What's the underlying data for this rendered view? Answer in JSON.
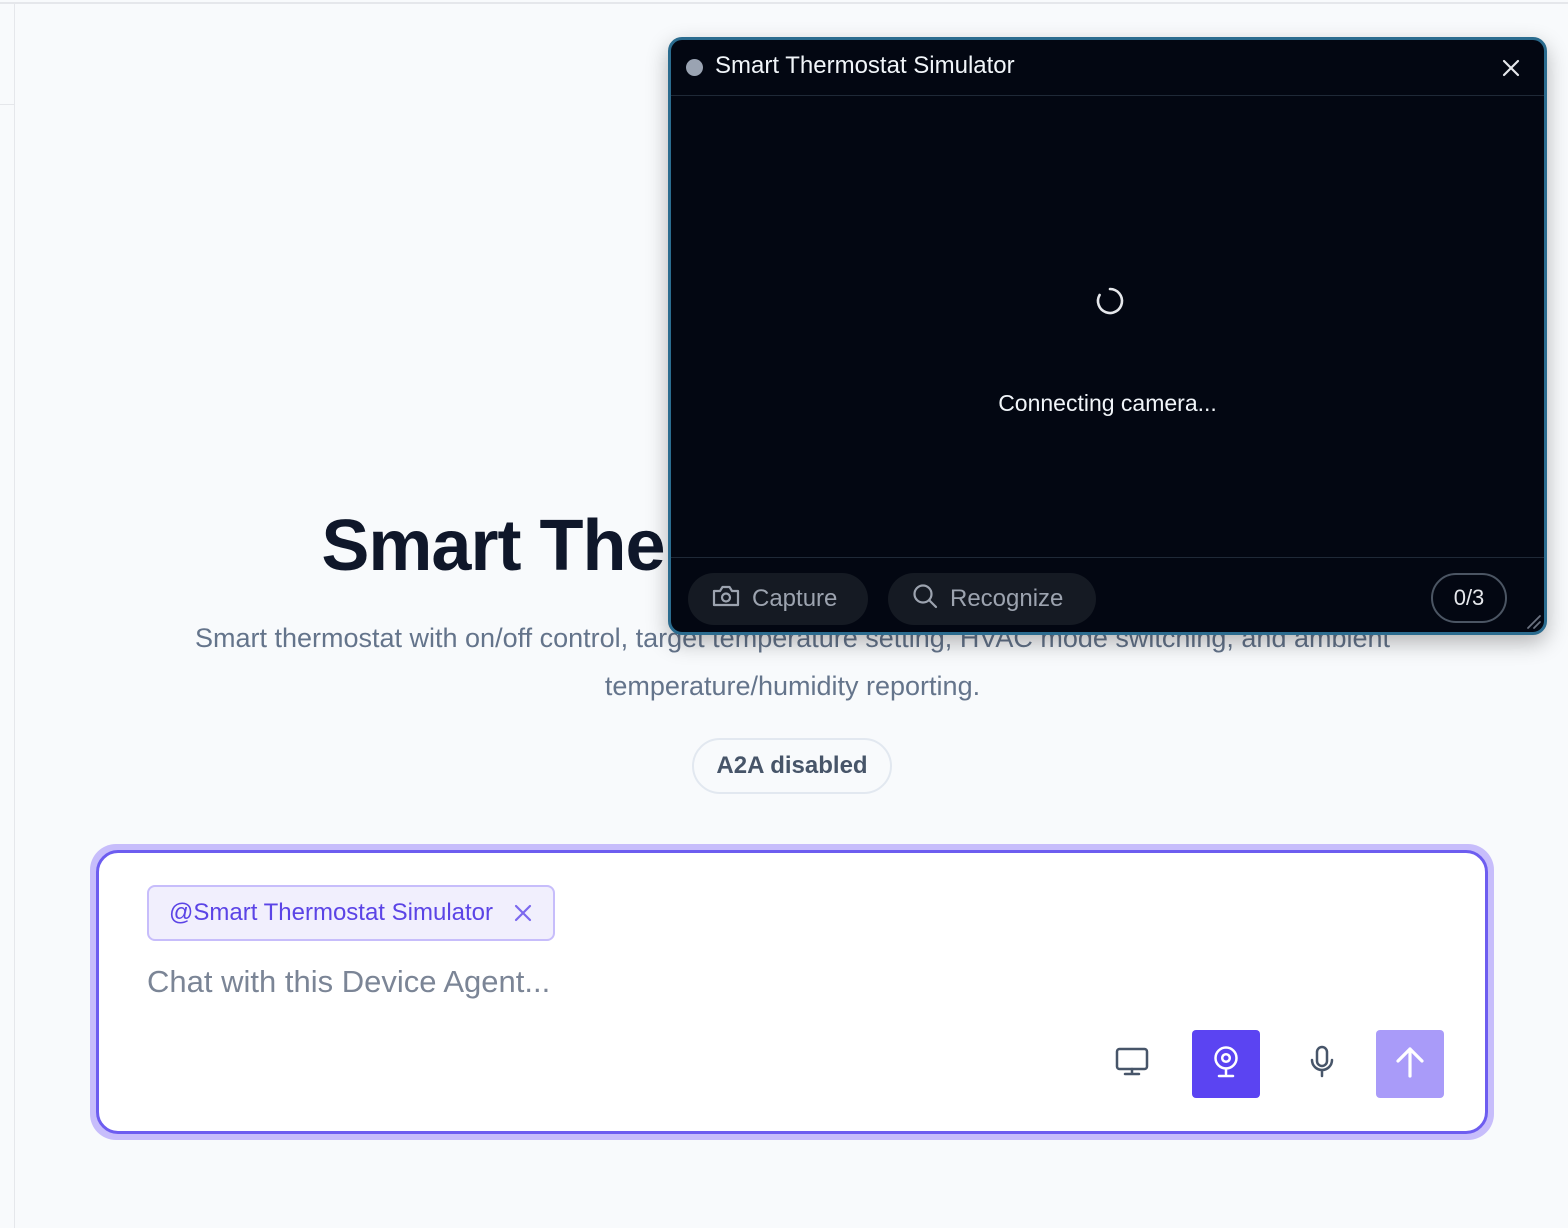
{
  "agent": {
    "title": "Smart Thermostat Simulator",
    "description": "Smart thermostat with on/off control, target temperature setting, HVAC mode switching, and ambient temperature/humidity reporting.",
    "a2a_status": "A2A disabled"
  },
  "composer": {
    "mention": "@Smart Thermostat Simulator",
    "placeholder": "Chat with this Device Agent..."
  },
  "camera_panel": {
    "title": "Smart Thermostat Simulator",
    "status": "Connecting camera...",
    "capture_label": "Capture",
    "recognize_label": "Recognize",
    "counter": "0/3"
  },
  "icons": {
    "status_dot": "status-dot-icon",
    "close": "close-icon",
    "spinner": "loading-spinner-icon",
    "capture": "camera-icon",
    "recognize": "search-icon",
    "resize": "resize-handle-icon",
    "mention_remove": "close-icon",
    "screen": "monitor-icon",
    "webcam": "webcam-icon",
    "mic": "microphone-icon",
    "send": "arrow-up-icon"
  },
  "colors": {
    "accent": "#5b44f2",
    "send_disabled": "#a99bf9",
    "panel_bg": "#030712",
    "panel_border": "#2b6c8f"
  }
}
